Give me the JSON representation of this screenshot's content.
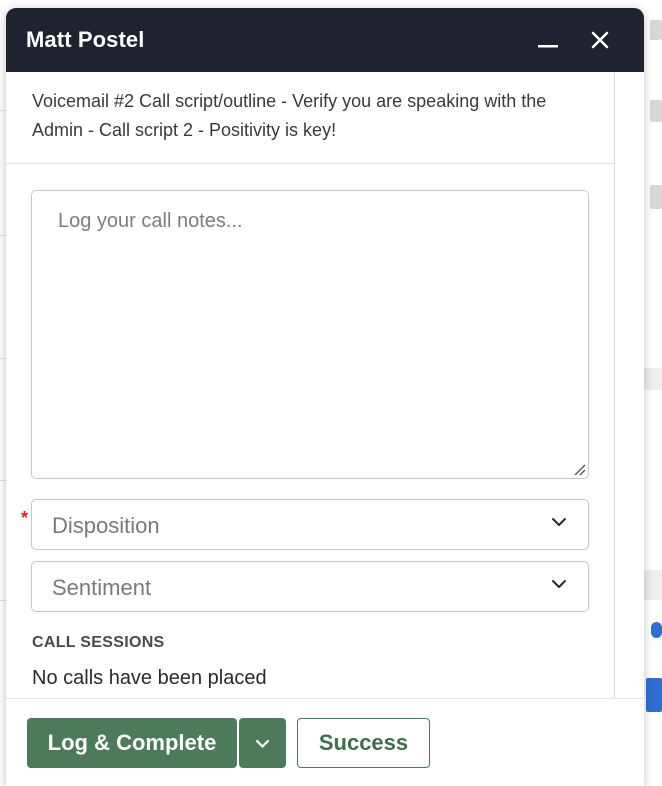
{
  "dialog": {
    "title": "Matt Postel",
    "script": "Voicemail #2 Call script/outline - Verify you are speaking with the Admin - Call script 2 - Positivity is key!",
    "icons": {
      "minimize": "minimize-icon",
      "close": "close-icon",
      "resize": "resize-grip-icon",
      "dropdown": "chevron-down-icon"
    }
  },
  "notes": {
    "placeholder": "Log your call notes..."
  },
  "disposition": {
    "placeholder": "Disposition",
    "required_mark": "*"
  },
  "sentiment": {
    "placeholder": "Sentiment"
  },
  "call_sessions": {
    "heading": "CALL SESSIONS",
    "empty_text": "No calls have been placed"
  },
  "footer": {
    "log_complete_label": "Log & Complete",
    "success_label": "Success"
  },
  "colors": {
    "header_bg": "#1f2330",
    "accent_green": "#4c7a5b",
    "required_red": "#d0281f"
  }
}
